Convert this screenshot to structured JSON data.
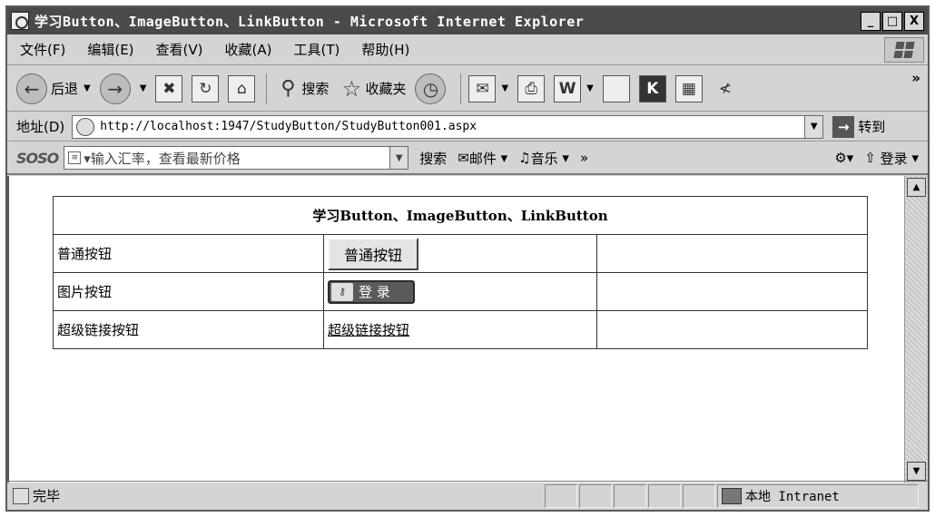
{
  "window": {
    "title": "学习Button、ImageButton、LinkButton - Microsoft Internet Explorer",
    "controls": {
      "minimize": "_",
      "maximize": "□",
      "close": "X"
    }
  },
  "menu": [
    "文件(F)",
    "编辑(E)",
    "查看(V)",
    "收藏(A)",
    "工具(T)",
    "帮助(H)"
  ],
  "toolbar": {
    "back_label": "后退",
    "search_label": "搜索",
    "favorites_label": "收藏夹",
    "more": "»"
  },
  "address": {
    "label": "地址(D)",
    "url": "http://localhost:1947/StudyButton/StudyButton001.aspx",
    "go_label": "转到"
  },
  "searchbar": {
    "logo": "SOSO",
    "placeholder": "▾输入汇率，查看最新价格",
    "search_label": "搜索",
    "mail_label": "邮件",
    "music_label": "音乐",
    "more": "»",
    "login_label": "登录"
  },
  "page": {
    "table_title": "学习Button、ImageButton、LinkButton",
    "rows": [
      {
        "label": "普通按钮",
        "control_text": "普通按钮"
      },
      {
        "label": "图片按钮",
        "control_text": "登 录"
      },
      {
        "label": "超级链接按钮",
        "control_text": "超级链接按钮"
      }
    ]
  },
  "status": {
    "text": "完毕",
    "zone": "本地 Intranet"
  }
}
